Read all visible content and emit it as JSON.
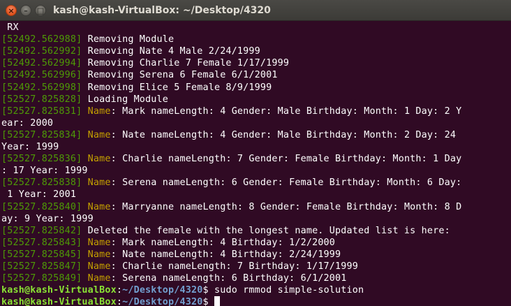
{
  "window": {
    "title": "kash@kash-VirtualBox: ~/Desktop/4320",
    "close_symbol": "×",
    "minimize_symbol": "–",
    "maximize_symbol": "□"
  },
  "terminal": {
    "colors": {
      "background": "#300a24",
      "text": "#ffffff",
      "timestamp": "#4e9a06",
      "name_label": "#c4a000",
      "user": "#8ae234",
      "path": "#729fcf"
    },
    "lines": [
      {
        "text": " RX"
      },
      {
        "ts": "[52492.562988]",
        "text": " Removing Module"
      },
      {
        "ts": "[52492.562992]",
        "text": " Removing Nate 4 Male 2/24/1999"
      },
      {
        "ts": "[52492.562994]",
        "text": " Removing Charlie 7 Female 1/17/1999"
      },
      {
        "ts": "[52492.562996]",
        "text": " Removing Serena 6 Female 6/1/2001"
      },
      {
        "ts": "[52492.562998]",
        "text": " Removing Elice 5 Female 8/9/1999"
      },
      {
        "ts": "[52527.825828]",
        "text": " Loading Module"
      },
      {
        "ts": "[52527.825831]",
        "label": " Name",
        "text": ": Mark nameLength: 4 Gender: Male Birthday: Month: 1 Day: 2 Y"
      },
      {
        "text": "ear: 2000"
      },
      {
        "ts": "[52527.825834]",
        "label": " Name",
        "text": ": Nate nameLength: 4 Gender: Male Birthday: Month: 2 Day: 24"
      },
      {
        "text": "Year: 1999"
      },
      {
        "ts": "[52527.825836]",
        "label": " Name",
        "text": ": Charlie nameLength: 7 Gender: Female Birthday: Month: 1 Day"
      },
      {
        "text": ": 17 Year: 1999"
      },
      {
        "ts": "[52527.825838]",
        "label": " Name",
        "text": ": Serena nameLength: 6 Gender: Female Birthday: Month: 6 Day:"
      },
      {
        "text": " 1 Year: 2001"
      },
      {
        "ts": "[52527.825840]",
        "label": " Name",
        "text": ": Marryanne nameLength: 8 Gender: Female Birthday: Month: 8 D"
      },
      {
        "text": "ay: 9 Year: 1999"
      },
      {
        "ts": "[52527.825842]",
        "text": " Deleted the female with the longest name. Updated list is here:"
      },
      {
        "ts": "[52527.825843]",
        "label": " Name",
        "text": ": Mark nameLength: 4 Birthday: 1/2/2000"
      },
      {
        "ts": "[52527.825845]",
        "label": " Name",
        "text": ": Nate nameLength: 4 Birthday: 2/24/1999"
      },
      {
        "ts": "[52527.825847]",
        "label": " Name",
        "text": ": Charlie nameLength: 7 Birthday: 1/17/1999"
      },
      {
        "ts": "[52527.825849]",
        "label": " Name",
        "text": ": Serena nameLength: 6 Birthday: 6/1/2001"
      },
      {
        "user": "kash@kash-VirtualBox",
        "sep": ":",
        "path": "~/Desktop/4320",
        "prompt": "$ ",
        "command": "sudo rmmod simple-solution"
      },
      {
        "user": "kash@kash-VirtualBox",
        "sep": ":",
        "path": "~/Desktop/4320",
        "prompt": "$ ",
        "command": "",
        "cursor": true
      }
    ]
  }
}
